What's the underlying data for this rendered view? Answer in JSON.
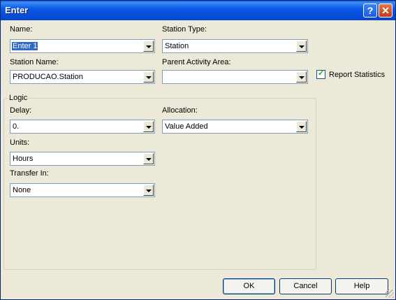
{
  "window": {
    "title": "Enter"
  },
  "fields": {
    "name": {
      "label": "Name:",
      "value": "Enter 1"
    },
    "station_type": {
      "label": "Station Type:",
      "value": "Station"
    },
    "station_name": {
      "label": "Station Name:",
      "value": "PRODUCAO.Station"
    },
    "parent_activity_area": {
      "label": "Parent Activity Area:",
      "value": ""
    },
    "report_statistics": {
      "label": "Report Statistics",
      "checked": true
    }
  },
  "logic": {
    "title": "Logic",
    "delay": {
      "label": "Delay:",
      "value": "0."
    },
    "allocation": {
      "label": "Allocation:",
      "value": "Value Added"
    },
    "units": {
      "label": "Units:",
      "value": "Hours"
    },
    "transfer_in": {
      "label": "Transfer In:",
      "value": "None"
    }
  },
  "buttons": {
    "ok": "OK",
    "cancel": "Cancel",
    "help": "Help"
  },
  "colors": {
    "title_bar": "#0A5AE6",
    "dialog_bg": "#ECE9D8",
    "selection": "#316AC5",
    "checkmark": "#21A121"
  }
}
